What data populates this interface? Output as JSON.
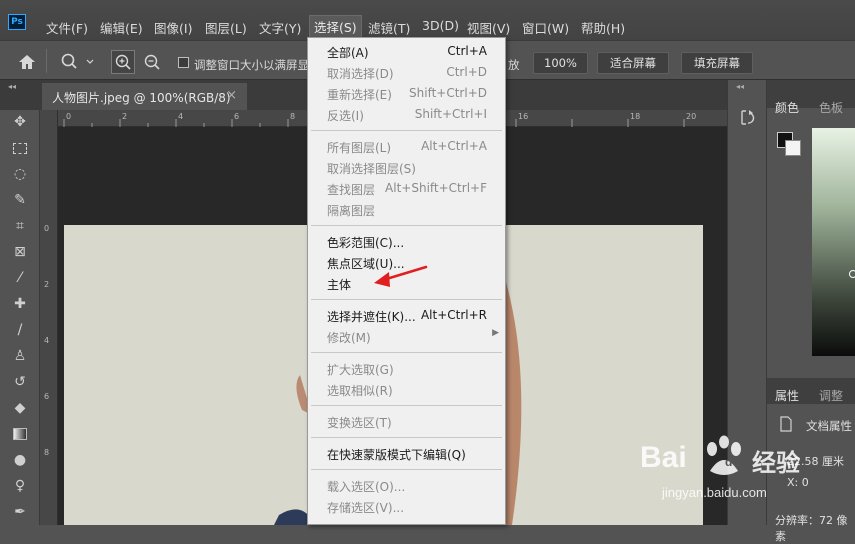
{
  "app": {
    "logo": "Ps"
  },
  "menubar": {
    "items": [
      "文件(F)",
      "编辑(E)",
      "图像(I)",
      "图层(L)",
      "文字(Y)",
      "选择(S)",
      "滤镜(T)",
      "3D(D)",
      "视图(V)",
      "窗口(W)",
      "帮助(H)"
    ],
    "active": "选择(S)"
  },
  "options": {
    "resize_checkbox_label": "调整窗口大小以满屏显",
    "fit_partial": "放",
    "zoom_value": "100%",
    "fit_screen_label": "适合屏幕",
    "fill_screen_label": "填充屏幕"
  },
  "document": {
    "tab_title": "人物图片.jpeg @ 100%(RGB/8)",
    "close_glyph": "×"
  },
  "rulers": {
    "top_numbers": [
      "0",
      "2",
      "4",
      "6",
      "8",
      "16",
      "18",
      "20"
    ],
    "left_numbers": [
      "0",
      "2",
      "4",
      "6",
      "8"
    ]
  },
  "select_menu": {
    "items": [
      {
        "label": "全部(A)",
        "shortcut": "Ctrl+A",
        "disabled": false
      },
      {
        "label": "取消选择(D)",
        "shortcut": "Ctrl+D",
        "disabled": true
      },
      {
        "label": "重新选择(E)",
        "shortcut": "Shift+Ctrl+D",
        "disabled": true
      },
      {
        "label": "反选(I)",
        "shortcut": "Shift+Ctrl+I",
        "disabled": true
      },
      {
        "label": "所有图层(L)",
        "shortcut": "Alt+Ctrl+A",
        "disabled": true
      },
      {
        "label": "取消选择图层(S)",
        "shortcut": "",
        "disabled": true
      },
      {
        "label": "查找图层",
        "shortcut": "Alt+Shift+Ctrl+F",
        "disabled": true
      },
      {
        "label": "隔离图层",
        "shortcut": "",
        "disabled": true
      },
      {
        "label": "色彩范围(C)...",
        "shortcut": "",
        "disabled": false
      },
      {
        "label": "焦点区域(U)...",
        "shortcut": "",
        "disabled": false
      },
      {
        "label": "主体",
        "shortcut": "",
        "disabled": false
      },
      {
        "label": "选择并遮住(K)...",
        "shortcut": "Alt+Ctrl+R",
        "disabled": false
      },
      {
        "label": "修改(M)",
        "shortcut": "",
        "disabled": true
      },
      {
        "label": "扩大选取(G)",
        "shortcut": "",
        "disabled": true
      },
      {
        "label": "选取相似(R)",
        "shortcut": "",
        "disabled": true
      },
      {
        "label": "变换选区(T)",
        "shortcut": "",
        "disabled": true
      },
      {
        "label": "在快速蒙版模式下编辑(Q)",
        "shortcut": "",
        "disabled": false
      },
      {
        "label": "载入选区(O)...",
        "shortcut": "",
        "disabled": true
      },
      {
        "label": "存储选区(V)...",
        "shortcut": "",
        "disabled": true
      }
    ]
  },
  "right_panel": {
    "color_tab": "颜色",
    "swatch_tab": "色板",
    "properties_tab": "属性",
    "adjust_tab": "调整",
    "doc_properties": "文档属性",
    "width_text": "22.58 厘米",
    "x_text": "X: 0",
    "resolution_text": "分辨率：72 像素"
  },
  "watermark": {
    "brand": "Bai",
    "brand2": "du",
    "jingyan": "经验",
    "url": "jingyan.baidu.com"
  },
  "colors": {
    "annotation_arrow": "#e02020",
    "ps_blue": "#31a8ff"
  }
}
